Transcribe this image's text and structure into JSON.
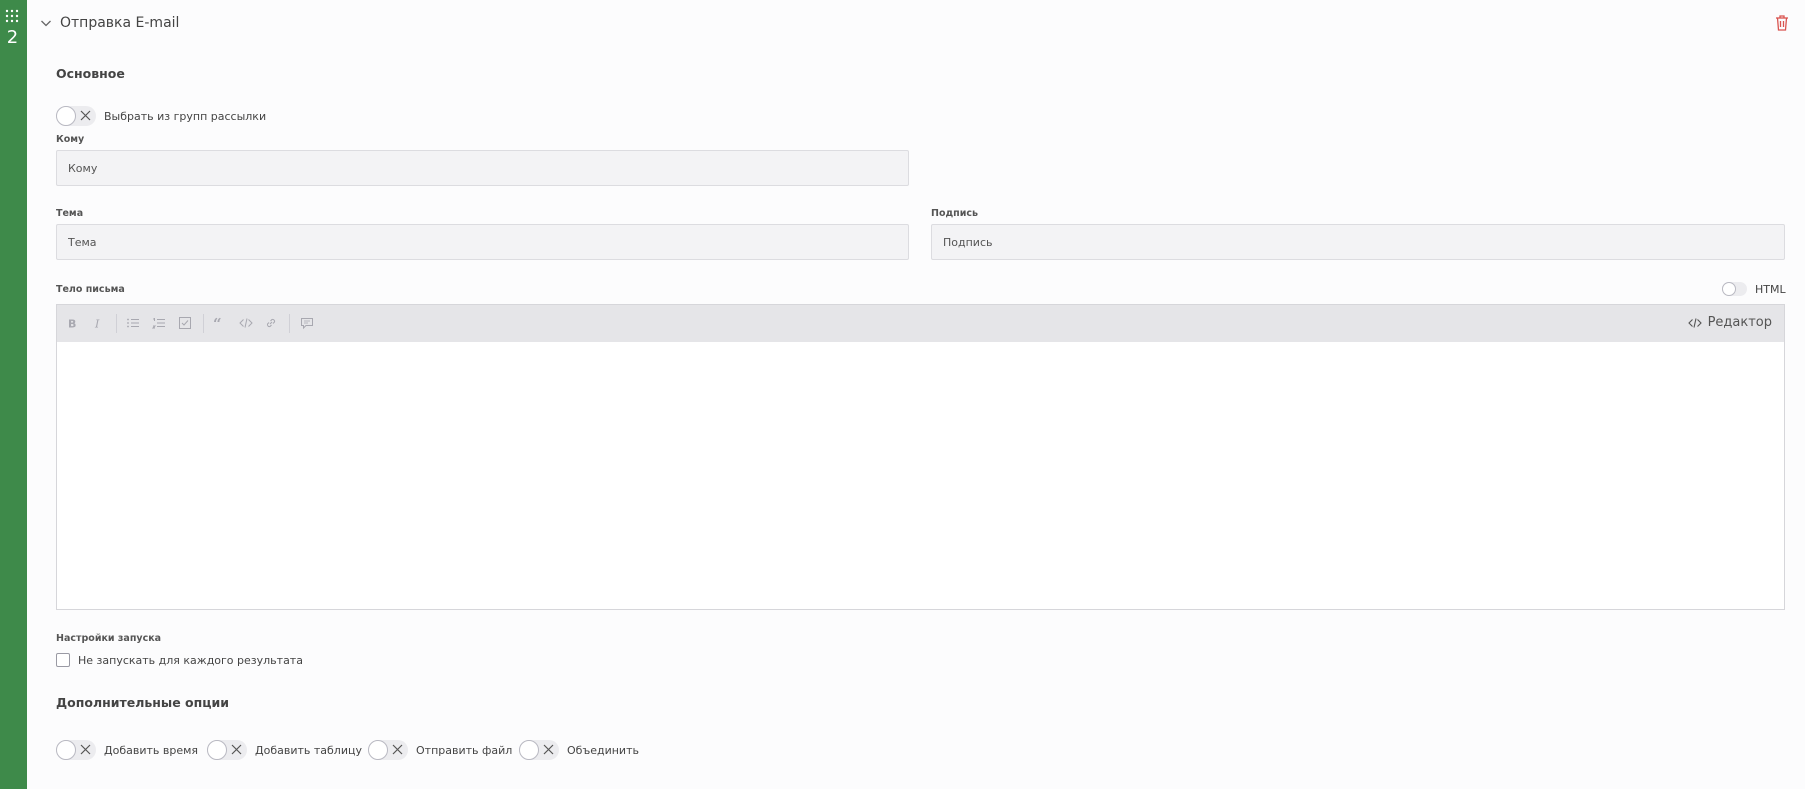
{
  "step": {
    "number": "2"
  },
  "header": {
    "title": "Отправка E-mail"
  },
  "main": {
    "section_basic": "Основное",
    "mailing_groups_toggle": "Выбрать из групп рассылки",
    "to": {
      "label": "Кому",
      "placeholder": "Кому"
    },
    "subject": {
      "label": "Тема",
      "placeholder": "Тема"
    },
    "signature": {
      "label": "Подпись",
      "placeholder": "Подпись"
    },
    "body": {
      "label": "Тело письма",
      "html_toggle": "HTML",
      "toolbar": {
        "mode_label": "Редактор",
        "buttons": [
          "bold",
          "italic",
          "bullet-list",
          "numbered-list",
          "task-list",
          "quote",
          "code",
          "link",
          "comment"
        ]
      }
    },
    "launch_settings": {
      "label": "Настройки запуска",
      "checkbox": "Не запускать для каждого результата"
    },
    "extra_options": {
      "title": "Дополнительные опции",
      "toggles": [
        "Добавить время",
        "Добавить таблицу",
        "Отправить файл",
        "Объединить"
      ]
    }
  },
  "colors": {
    "rail": "#3e8a4a",
    "delete": "#d9534f"
  }
}
